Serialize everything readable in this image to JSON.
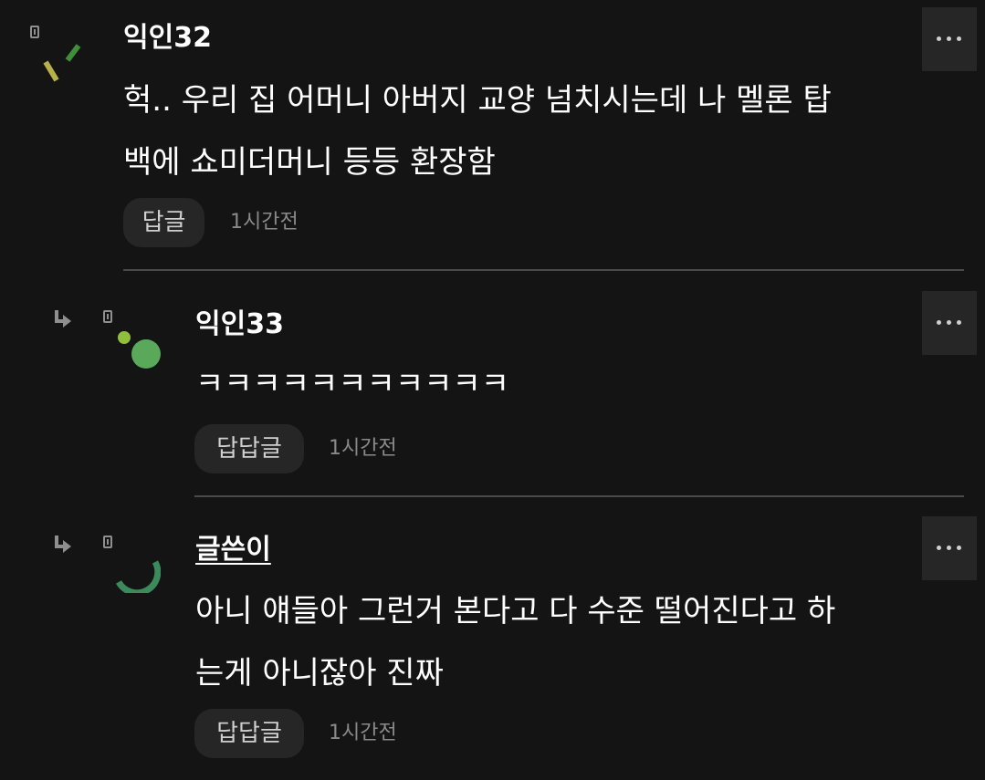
{
  "comments": [
    {
      "username": "익인32",
      "is_author": false,
      "body_lines": [
        "헉.. 우리 집 어머니 아버지 교양 넘치시는데 나 멜론 탑",
        "백에 쇼미더머니 등등 환장함"
      ],
      "reply_label": "답글",
      "timestamp": "1시간전",
      "avatar_colors": [
        "#b8b14a",
        "#3f8f3a"
      ]
    },
    {
      "username": "익인33",
      "is_author": false,
      "body_lines": [
        "ㅋㅋㅋㅋㅋㅋㅋㅋㅋㅋㅋ"
      ],
      "reply_label": "답답글",
      "timestamp": "1시간전",
      "avatar_colors": [
        "#5aa85a",
        "#8fbf3c"
      ]
    },
    {
      "username": "글쓴이",
      "is_author": true,
      "body_lines": [
        "아니 얘들아 그런거 본다고 다 수준 떨어진다고 하",
        "는게 아니잖아 진짜"
      ],
      "reply_label": "답답글",
      "timestamp": "1시간전",
      "avatar_colors": [
        "#3c8a5c"
      ]
    }
  ],
  "icons": {
    "badge": "badge-icon",
    "reply_arrow": "reply-arrow-icon",
    "more": "more-options-icon"
  },
  "colors": {
    "background": "#141414",
    "button_bg": "#262626",
    "text_primary": "#ffffff",
    "text_secondary": "#8a8a8a",
    "divider": "#4a4a4a"
  }
}
